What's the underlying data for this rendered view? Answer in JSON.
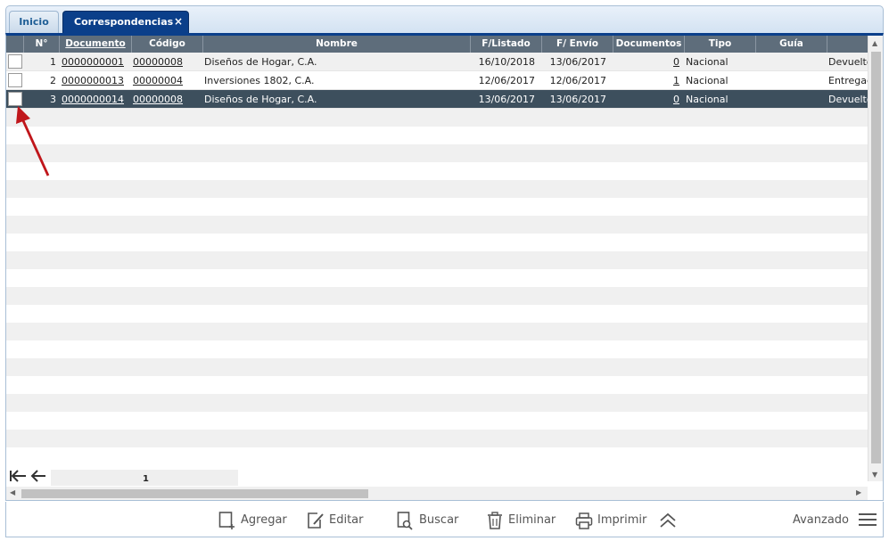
{
  "tabs": {
    "inicio": "Inicio",
    "correspondencias": "Correspondencias",
    "close_glyph": "×"
  },
  "columns": {
    "no": "N°",
    "documento": "Documento",
    "codigo": "Código",
    "nombre": "Nombre",
    "f_listado": "F/Listado",
    "f_envio": "F/ Envío",
    "documentos": "Documentos",
    "tipo": "Tipo",
    "guia": "Guía",
    "status": ""
  },
  "rows": [
    {
      "no": "1",
      "documento": "0000000001",
      "codigo": "00000008",
      "nombre": "Diseños de Hogar, C.A.",
      "f_listado": "16/10/2018",
      "f_envio": "13/06/2017",
      "documentos": "0",
      "tipo": "Nacional",
      "guia": "",
      "status": "Devuelto"
    },
    {
      "no": "2",
      "documento": "0000000013",
      "codigo": "00000004",
      "nombre": "Inversiones 1802, C.A.",
      "f_listado": "12/06/2017",
      "f_envio": "12/06/2017",
      "documentos": "1",
      "tipo": "Nacional",
      "guia": "",
      "status": "Entregado"
    },
    {
      "no": "3",
      "documento": "0000000014",
      "codigo": "00000008",
      "nombre": "Diseños de Hogar, C.A.",
      "f_listado": "13/06/2017",
      "f_envio": "13/06/2017",
      "documentos": "0",
      "tipo": "Nacional",
      "guia": "",
      "status": "Devuelto"
    }
  ],
  "pager": {
    "page": "1"
  },
  "toolbar": {
    "agregar": "Agregar",
    "editar": "Editar",
    "buscar": "Buscar",
    "eliminar": "Eliminar",
    "imprimir": "Imprimir",
    "avanzado": "Avanzado"
  },
  "colors": {
    "tab_active": "#0b3f8a",
    "header": "#5e6d7b",
    "selected_row": "#3d4f5d",
    "annotation_arrow": "#c0161b"
  },
  "icons": {
    "first_page": "first-page-icon",
    "prev_page": "prev-page-icon",
    "close": "close-icon",
    "collapse": "double-chevron-up-icon",
    "menu": "hamburger-menu-icon"
  }
}
